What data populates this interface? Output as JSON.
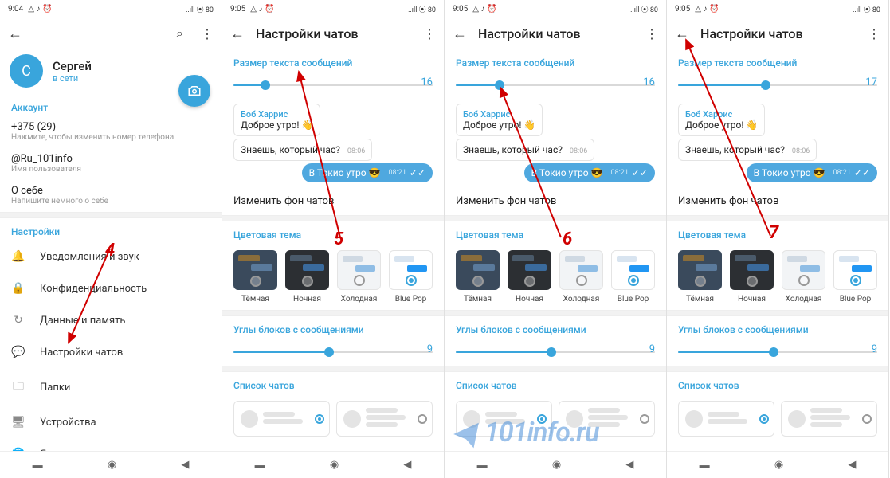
{
  "screen1": {
    "statusbar_time": "9:04",
    "statusbar_icons": "△ ♪ ⏰",
    "signal_icons": "..ıll ⦿ 80",
    "name": "Сергей",
    "status": "в сети",
    "account_label": "Аккаунт",
    "phone": "+375 (29)",
    "phone_sub": "Нажмите, чтобы изменить номер телефона",
    "username": "@Ru_101info",
    "username_sub": "Имя пользователя",
    "about": "О себе",
    "about_sub": "Напишите немного о себе",
    "settings_label": "Настройки",
    "items": [
      {
        "label": "Уведомления и звук"
      },
      {
        "label": "Конфиденциальность"
      },
      {
        "label": "Данные и память"
      },
      {
        "label": "Настройки чатов"
      },
      {
        "label": "Папки"
      },
      {
        "label": "Устройства"
      },
      {
        "label": "Язык"
      }
    ],
    "annot": "4"
  },
  "shared": {
    "statusbar_time": "9:05",
    "header": "Настройки чатов",
    "size_label": "Размер текста сообщений",
    "sender": "Боб Харрис",
    "msg1": "Доброе утро! 👋",
    "msg2": "Знаешь, который час?",
    "msg2_time": "08:06",
    "msg_out": "В Токио утро 😎",
    "msg_out_time": "08:21",
    "bg_label": "Изменить фон чатов",
    "theme_label": "Цветовая тема",
    "themes": [
      "Тёмная",
      "Ночная",
      "Холодная",
      "Blue Pop"
    ],
    "corners_label": "Углы блоков с сообщениями",
    "corners_val": "9",
    "chatlist_label": "Список чатов"
  },
  "screen2": {
    "size_val": "16",
    "fill_pct": 16,
    "annot": "5"
  },
  "screen3": {
    "size_val": "16",
    "fill_pct": 22,
    "annot": "6"
  },
  "screen4": {
    "size_val": "17",
    "fill_pct": 44,
    "annot": "7"
  },
  "watermark": "101info.ru"
}
